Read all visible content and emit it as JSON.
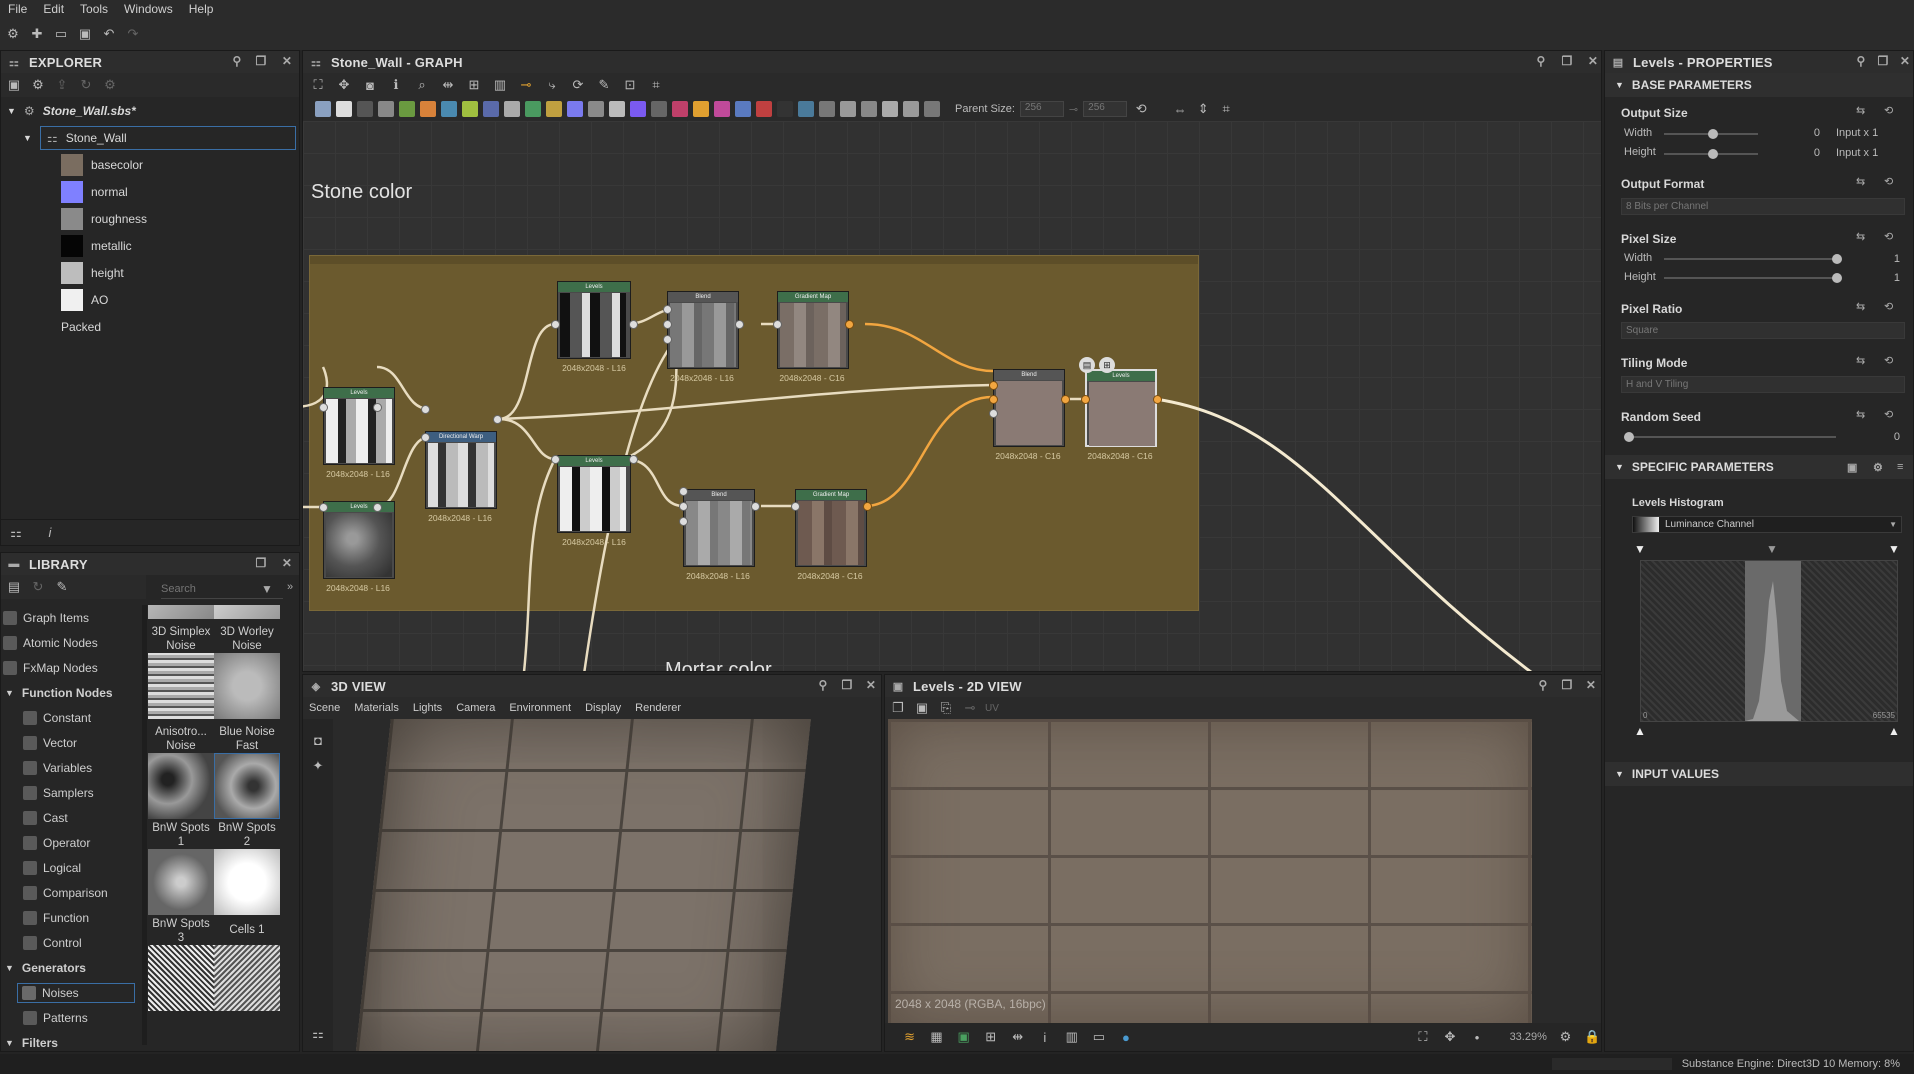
{
  "menu": [
    "File",
    "Edit",
    "Tools",
    "Windows",
    "Help"
  ],
  "explorer": {
    "title": "EXPLORER",
    "package": "Stone_Wall.sbs*",
    "graph": "Stone_Wall",
    "outputs": [
      "basecolor",
      "normal",
      "roughness",
      "metallic",
      "height",
      "AO"
    ],
    "packed": "Packed"
  },
  "graph": {
    "title": "Stone_Wall - GRAPH",
    "parent_size_label": "Parent Size:",
    "parent_size_value": "256",
    "size_value_2": "256",
    "frame_title": "Stone color",
    "frame_label_cut": "Mortar color",
    "nodes": {
      "levels_top": {
        "title": "Levels",
        "label": "2048x2048 - L16"
      },
      "blend_top": {
        "title": "Blend",
        "label": "2048x2048 - L16"
      },
      "gradmap_top": {
        "title": "Gradient Map",
        "label": "2048x2048 - C16"
      },
      "levels_left1": {
        "title": "Levels",
        "label": "2048x2048 - L16"
      },
      "levels_left2": {
        "title": "Levels",
        "label": "2048x2048 - L16"
      },
      "dirwarp": {
        "title": "Directional Warp",
        "label": "2048x2048 - L16"
      },
      "levels_mid": {
        "title": "Levels",
        "label": "2048x2048 - L16"
      },
      "blend_bottom": {
        "title": "Blend",
        "label": "2048x2048 - L16"
      },
      "gradmap_bottom": {
        "title": "Gradient Map",
        "label": "2048x2048 - C16"
      },
      "blend_final": {
        "title": "Blend",
        "label": "2048x2048 - C16"
      },
      "levels_out": {
        "title": "Levels",
        "label": "2048x2048 - C16"
      }
    }
  },
  "library": {
    "title": "LIBRARY",
    "search_placeholder": "Search",
    "categories": [
      "Graph Items",
      "Atomic Nodes",
      "FxMap Nodes"
    ],
    "function_nodes": "Function Nodes",
    "function_items": [
      "Constant",
      "Vector",
      "Variables",
      "Samplers",
      "Cast",
      "Operator",
      "Logical",
      "Comparison",
      "Function",
      "Control"
    ],
    "generators": "Generators",
    "generator_items": [
      "Noises",
      "Patterns"
    ],
    "filters": "Filters",
    "thumbs": [
      {
        "line1": "3D Simplex",
        "line2": "Noise"
      },
      {
        "line1": "3D Worley",
        "line2": "Noise"
      },
      {
        "line1": "Anisotro...",
        "line2": "Noise"
      },
      {
        "line1": "Blue Noise",
        "line2": "Fast"
      },
      {
        "line1": "BnW Spots",
        "line2": "1"
      },
      {
        "line1": "BnW Spots",
        "line2": "2"
      },
      {
        "line1": "BnW Spots",
        "line2": "3"
      },
      {
        "line1": "Cells 1",
        "line2": ""
      }
    ]
  },
  "view3d": {
    "title": "3D VIEW",
    "menu": [
      "Scene",
      "Materials",
      "Lights",
      "Camera",
      "Environment",
      "Display",
      "Renderer"
    ]
  },
  "view2d": {
    "title": "Levels - 2D VIEW",
    "uv": "UV",
    "info": "2048 x 2048 (RGBA, 16bpc)",
    "zoom": "33.29%"
  },
  "properties": {
    "title": "Levels - PROPERTIES",
    "base_section": "BASE PARAMETERS",
    "output_size": "Output Size",
    "width": "Width",
    "height": "Height",
    "output_width_value": "0",
    "output_height_value": "0",
    "input_x1": "Input x 1",
    "output_format": "Output Format",
    "output_format_value": "8 Bits per Channel",
    "pixel_size": "Pixel Size",
    "pixel_width_value": "1",
    "pixel_height_value": "1",
    "pixel_ratio": "Pixel Ratio",
    "pixel_ratio_value": "Square",
    "tiling_mode": "Tiling Mode",
    "tiling_mode_value": "H and V Tiling",
    "random_seed": "Random Seed",
    "random_seed_value": "0",
    "specific_section": "SPECIFIC PARAMETERS",
    "levels_histogram": "Levels Histogram",
    "channel": "Luminance Channel",
    "hist_min": "0",
    "hist_max": "65535",
    "input_values": "INPUT VALUES"
  },
  "status": {
    "engine": "Substance Engine: Direct3D 10  Memory: 8%"
  },
  "colors": {
    "frame": "#6b5a2e",
    "wire_orange": "#f2a640",
    "wire_light": "#e8dcc0"
  }
}
